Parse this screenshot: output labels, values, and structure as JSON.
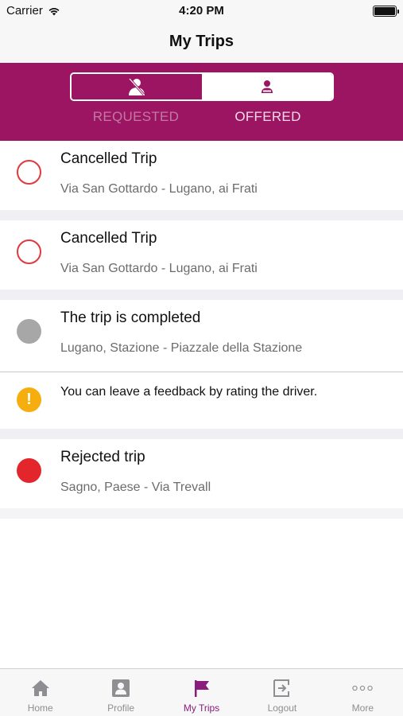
{
  "status_bar": {
    "carrier": "Carrier",
    "time": "4:20 PM"
  },
  "nav": {
    "title": "My Trips"
  },
  "segments": [
    {
      "label": "REQUESTED",
      "icon": "person-slash-icon",
      "selected": false
    },
    {
      "label": "OFFERED",
      "icon": "driver-icon",
      "selected": true
    }
  ],
  "trips": [
    {
      "title": "Cancelled Trip",
      "route": "Via San Gottardo - Lugano, ai Frati",
      "status": "cancelled"
    },
    {
      "title": "Cancelled Trip",
      "route": "Via San Gottardo - Lugano, ai Frati",
      "status": "cancelled"
    },
    {
      "title": "The trip is completed",
      "route": "Lugano, Stazione - Piazzale della Stazione",
      "status": "completed"
    },
    {
      "title": "Rejected trip",
      "route": "Sagno, Paese - Via Trevall",
      "status": "rejected"
    }
  ],
  "feedback": {
    "text": "You can leave a feedback by rating the driver."
  },
  "tabs": [
    {
      "label": "Home",
      "icon": "home-icon"
    },
    {
      "label": "Profile",
      "icon": "profile-icon"
    },
    {
      "label": "My Trips",
      "icon": "flag-icon",
      "selected": true
    },
    {
      "label": "Logout",
      "icon": "logout-icon"
    },
    {
      "label": "More",
      "icon": "more-icon"
    }
  ],
  "colors": {
    "accent": "#9c1562",
    "tab_selected": "#8a1c7c",
    "cancelled": "#e0393e",
    "completed": "#a7a7a7",
    "rejected": "#e3262c",
    "warning": "#f6ae0f"
  }
}
